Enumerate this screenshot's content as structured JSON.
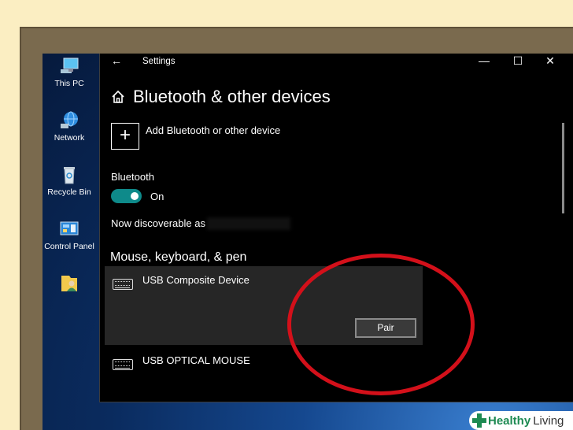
{
  "desktop": {
    "icons": [
      {
        "label": "This PC",
        "icon": "computer-icon"
      },
      {
        "label": "Network",
        "icon": "network-globe-icon"
      },
      {
        "label": "Recycle Bin",
        "icon": "recycle-bin-icon"
      },
      {
        "label": "Control Panel",
        "icon": "control-panel-icon"
      },
      {
        "label": "",
        "icon": "user-folder-icon"
      }
    ]
  },
  "window": {
    "title": "Settings",
    "back_icon": "←",
    "minimize_icon": "—",
    "maximize_icon": "☐",
    "close_icon": "✕"
  },
  "page": {
    "title": "Bluetooth & other devices",
    "home_icon": "home-icon",
    "add_device_symbol": "+",
    "add_device_label": "Add Bluetooth or other device",
    "bluetooth_label": "Bluetooth",
    "bluetooth_state": "On",
    "discoverable_label": "Now discoverable as"
  },
  "devices_section": {
    "heading": "Mouse, keyboard, & pen",
    "devices": [
      {
        "name": "USB Composite Device",
        "icon": "keyboard-icon",
        "action": "Pair"
      },
      {
        "name": "USB OPTICAL MOUSE",
        "icon": "keyboard-icon"
      }
    ]
  },
  "colors": {
    "toggle_on": "#0e8a8a",
    "highlight_circle": "#d3101a",
    "brand_green": "#1d8a52"
  },
  "watermark": {
    "brand_a": "Healthy",
    "brand_b": "Living"
  }
}
